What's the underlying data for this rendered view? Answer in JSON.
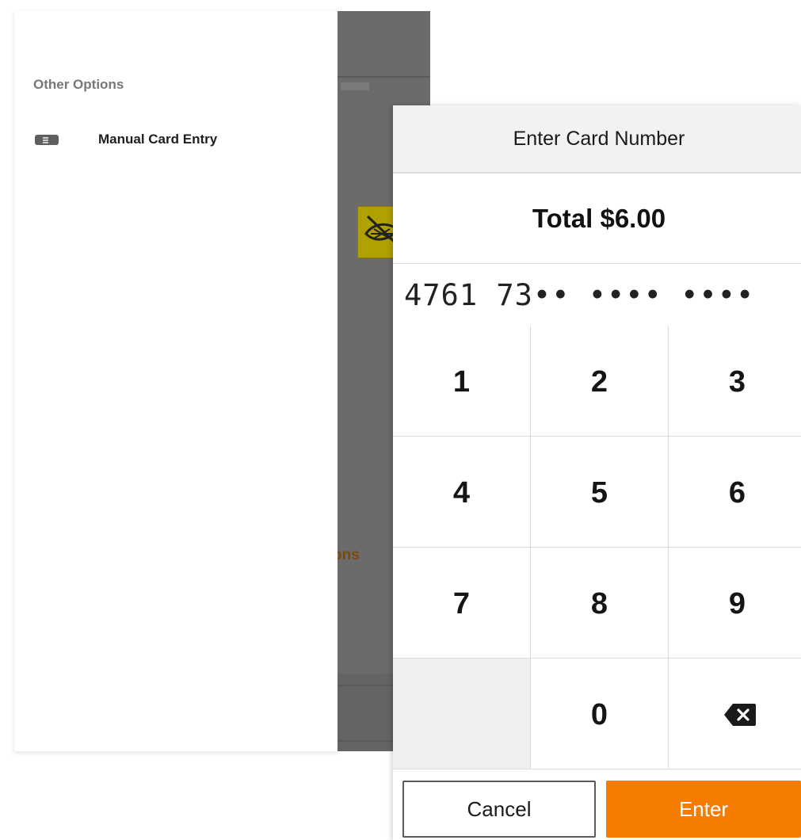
{
  "left_panel": {
    "section_title": "Other Options",
    "options": [
      {
        "label": "Manual Card Entry",
        "icon": "card-icon"
      }
    ]
  },
  "background": {
    "partial_text": "ons"
  },
  "dialog": {
    "title": "Enter Card Number",
    "total": "Total $6.00",
    "card_number": "4761 73•• •••• ••••",
    "keypad": {
      "keys": [
        "1",
        "2",
        "3",
        "4",
        "5",
        "6",
        "7",
        "8",
        "9",
        "",
        "0",
        "backspace"
      ]
    },
    "cancel_label": "Cancel",
    "enter_label": "Enter"
  },
  "colors": {
    "accent": "#f57c00",
    "overlay": "#6b6b6b"
  }
}
